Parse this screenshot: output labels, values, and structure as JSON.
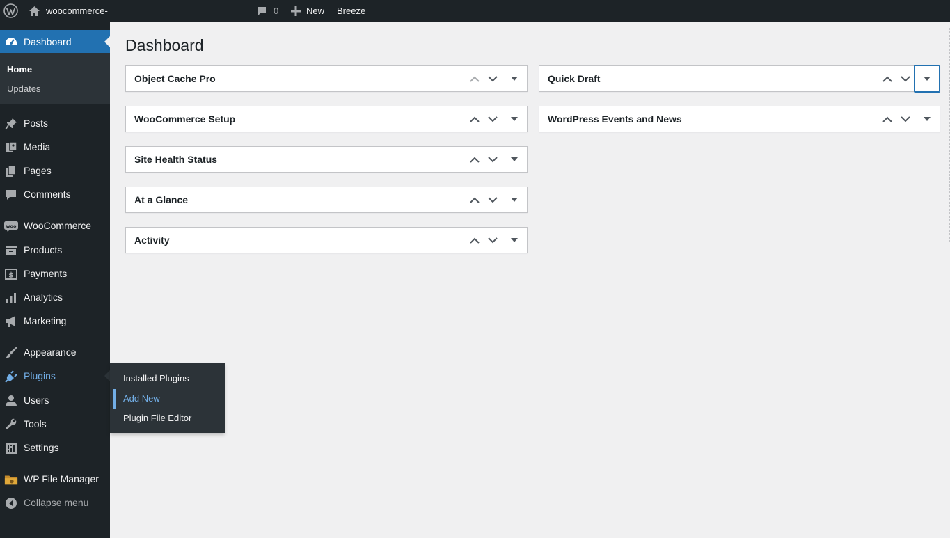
{
  "adminbar": {
    "site_name": "woocommerce-",
    "comments_count": "0",
    "new_label": "New",
    "breeze_label": "Breeze"
  },
  "sidebar": {
    "dashboard_label": "Dashboard",
    "dashboard_submenu": [
      "Home",
      "Updates"
    ],
    "items": [
      {
        "label": "Posts",
        "icon": "pushpin-icon"
      },
      {
        "label": "Media",
        "icon": "media-icon"
      },
      {
        "label": "Pages",
        "icon": "pages-icon"
      },
      {
        "label": "Comments",
        "icon": "comments-icon"
      },
      {
        "label": "WooCommerce",
        "icon": "woocommerce-icon"
      },
      {
        "label": "Products",
        "icon": "archive-icon"
      },
      {
        "label": "Payments",
        "icon": "dollar-icon"
      },
      {
        "label": "Analytics",
        "icon": "bar-chart-icon"
      },
      {
        "label": "Marketing",
        "icon": "megaphone-icon"
      },
      {
        "label": "Appearance",
        "icon": "paintbrush-icon"
      },
      {
        "label": "Plugins",
        "icon": "plug-icon"
      },
      {
        "label": "Users",
        "icon": "user-icon"
      },
      {
        "label": "Tools",
        "icon": "wrench-icon"
      },
      {
        "label": "Settings",
        "icon": "settings-icon"
      },
      {
        "label": "WP File Manager",
        "icon": "folder-icon"
      }
    ],
    "collapse_label": "Collapse menu"
  },
  "plugins_flyout": {
    "items": [
      "Installed Plugins",
      "Add New",
      "Plugin File Editor"
    ],
    "current": "Add New"
  },
  "main": {
    "page_title": "Dashboard",
    "left_widgets": [
      "Object Cache Pro",
      "WooCommerce Setup",
      "Site Health Status",
      "At a Glance",
      "Activity"
    ],
    "right_widgets": [
      "Quick Draft",
      "WordPress Events and News"
    ]
  },
  "colors": {
    "adminbar_bg": "#1d2327",
    "menu_bg": "#1d2327",
    "submenu_bg": "#2c3338",
    "accent": "#2271b1",
    "hover_blue": "#72aee6",
    "page_bg": "#f0f0f1"
  }
}
